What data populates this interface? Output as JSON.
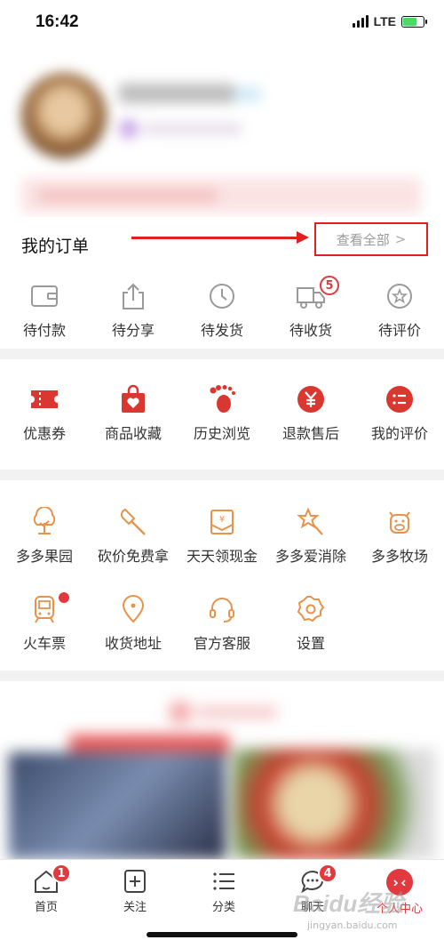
{
  "status_bar": {
    "time": "16:42",
    "network": "LTE"
  },
  "orders": {
    "title": "我的订单",
    "view_all": "查看全部",
    "items": [
      {
        "label": "待付款",
        "icon": "wallet-icon"
      },
      {
        "label": "待分享",
        "icon": "share-icon"
      },
      {
        "label": "待发货",
        "icon": "clock-icon"
      },
      {
        "label": "待收货",
        "icon": "truck-icon",
        "badge": "5"
      },
      {
        "label": "待评价",
        "icon": "review-icon"
      }
    ]
  },
  "tools": {
    "items": [
      {
        "label": "优惠券",
        "icon": "coupon-icon"
      },
      {
        "label": "商品收藏",
        "icon": "favorite-bag-icon"
      },
      {
        "label": "历史浏览",
        "icon": "footprint-icon"
      },
      {
        "label": "退款售后",
        "icon": "refund-icon"
      },
      {
        "label": "我的评价",
        "icon": "my-review-icon"
      }
    ]
  },
  "services": {
    "row1": [
      {
        "label": "多多果园",
        "icon": "tree-icon"
      },
      {
        "label": "砍价免费拿",
        "icon": "axe-icon"
      },
      {
        "label": "天天领现金",
        "icon": "cash-envelope-icon"
      },
      {
        "label": "多多爱消除",
        "icon": "star-wand-icon"
      },
      {
        "label": "多多牧场",
        "icon": "cow-icon"
      }
    ],
    "row2": [
      {
        "label": "火车票",
        "icon": "train-icon"
      },
      {
        "label": "收货地址",
        "icon": "location-icon"
      },
      {
        "label": "官方客服",
        "icon": "headset-icon"
      },
      {
        "label": "设置",
        "icon": "settings-icon"
      }
    ]
  },
  "tabbar": {
    "items": [
      {
        "label": "首页",
        "icon": "home-icon",
        "badge": "1"
      },
      {
        "label": "关注",
        "icon": "follow-icon"
      },
      {
        "label": "分类",
        "icon": "category-icon"
      },
      {
        "label": "聊天",
        "icon": "chat-icon",
        "badge": "4"
      },
      {
        "label": "个人中心",
        "icon": "profile-icon",
        "active": true
      }
    ]
  },
  "watermark": {
    "text": "Baidu经验",
    "sub": "jingyan.baidu.com"
  },
  "colors": {
    "accent": "#e0393e",
    "annotation": "#e02020",
    "line_icon": "#9a9a9a",
    "service_icon": "#e8924a"
  }
}
